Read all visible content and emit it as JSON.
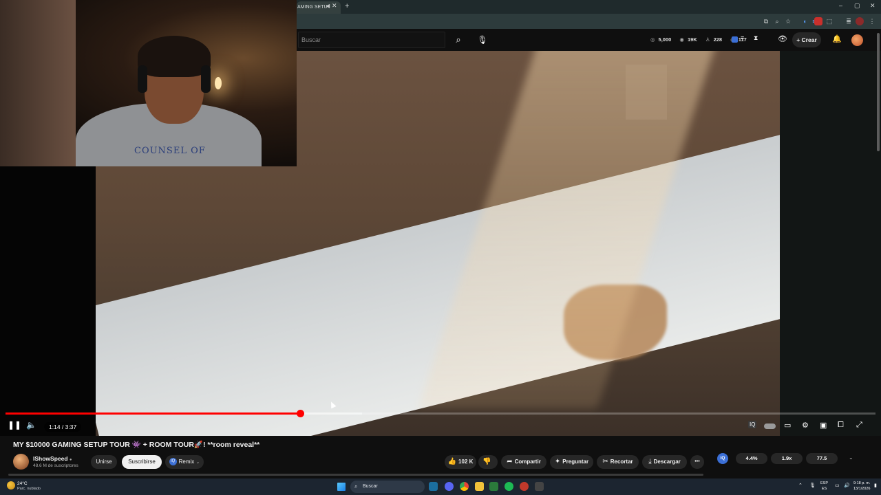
{
  "browser": {
    "tab_title": "AMING SETU",
    "tab_icons": "◀ ✕",
    "new_tab": "+",
    "window_controls": [
      "–",
      "▢",
      "✕"
    ]
  },
  "header": {
    "search_placeholder": "Buscar",
    "stats": {
      "goal": "5,000",
      "views": "19K",
      "users": "228",
      "watching": "117"
    },
    "create_label": "Crear"
  },
  "player": {
    "time": "1:14 / 3:37",
    "progress": {
      "played": 0.339,
      "buffered": 0.41
    }
  },
  "video": {
    "title": "MY $10000 GAMING SETUP TOUR 👾 + ROOM TOUR🚀! **room reveal**",
    "shirt_text": "COUNSEL OF"
  },
  "channel": {
    "name": "IShowSpeed",
    "verified": "●",
    "subscribers": "48.6 M de suscriptores",
    "join_label": "Unirse",
    "subscribe_label": "Suscribirse",
    "remix_label": "Remix",
    "remix_icon": "IQ"
  },
  "actions": {
    "likes": "102 K",
    "share": "Compartir",
    "ask": "Preguntar",
    "clip": "Recortar",
    "download": "Descargar",
    "more": "•••"
  },
  "metrics": {
    "iq_badge": "IQ",
    "m1": "4.4%",
    "m2": "1.9x",
    "m3": "77.5"
  },
  "taskbar": {
    "temperature": "24°C",
    "weather": "Parc. nublado",
    "search": "Buscar",
    "lang_top": "ESP",
    "lang_bottom": "ES",
    "time": "9:18 p. m.",
    "date": "13/1/2026"
  },
  "colors": {
    "accent_red": "#ff0000",
    "youtube_bg": "#0f0f0f",
    "iq_blue": "#3b6fd6"
  }
}
